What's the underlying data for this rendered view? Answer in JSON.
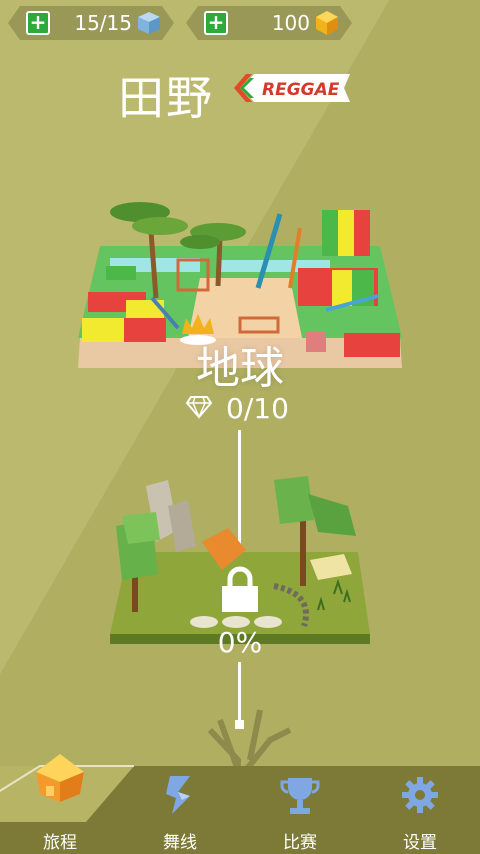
{
  "topbar": {
    "lives": {
      "value": "15/15",
      "icon": "blue-cube-icon"
    },
    "coins": {
      "value": "100",
      "icon": "gold-gem-icon"
    }
  },
  "header": {
    "title": "田野",
    "logo_text": "REGGAE"
  },
  "levels": [
    {
      "name": "地球",
      "score": "0/10",
      "locked": false
    },
    {
      "name": "",
      "progress": "0%",
      "locked": true
    }
  ],
  "nav": {
    "items": [
      {
        "label": "旅程",
        "icon": "house-icon",
        "active": true
      },
      {
        "label": "舞线",
        "icon": "dance-line-icon",
        "active": false
      },
      {
        "label": "比赛",
        "icon": "trophy-icon",
        "active": false
      },
      {
        "label": "设置",
        "icon": "gear-icon",
        "active": false
      }
    ]
  },
  "colors": {
    "background": "#b7b565",
    "nav_bar": "#7d7a37",
    "accent_green": "#2eaa3c",
    "gold": "#f2b21c",
    "cube_blue": "#7fb4de"
  }
}
